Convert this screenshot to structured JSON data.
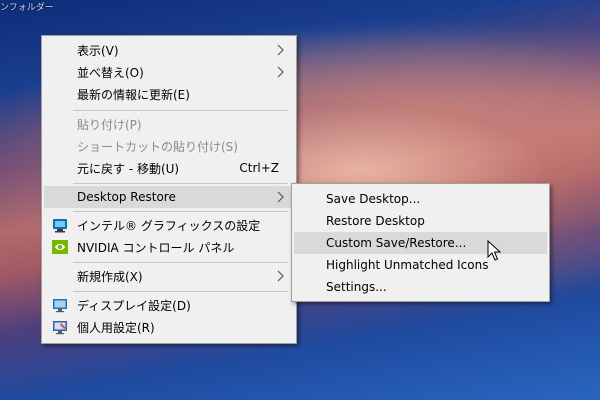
{
  "desktop": {
    "corner_label": "ンフォルダー"
  },
  "context_menu": {
    "items": [
      {
        "label": "表示(V)",
        "submenu": true
      },
      {
        "label": "並べ替え(O)",
        "submenu": true
      },
      {
        "label": "最新の情報に更新(E)"
      },
      {
        "label": "貼り付け(P)",
        "disabled": true
      },
      {
        "label": "ショートカットの貼り付け(S)",
        "disabled": true
      },
      {
        "label": "元に戻す - 移動(U)",
        "shortcut": "Ctrl+Z"
      },
      {
        "label": "Desktop Restore",
        "submenu": true,
        "highlighted": true
      },
      {
        "label": "インテル® グラフィックスの設定",
        "icon": "intel-graphics-icon"
      },
      {
        "label": "NVIDIA コントロール パネル",
        "icon": "nvidia-icon"
      },
      {
        "label": "新規作成(X)",
        "submenu": true
      },
      {
        "label": "ディスプレイ設定(D)",
        "icon": "display-icon"
      },
      {
        "label": "個人用設定(R)",
        "icon": "personalize-icon"
      }
    ]
  },
  "submenu": {
    "items": [
      {
        "label": "Save Desktop..."
      },
      {
        "label": "Restore Desktop"
      },
      {
        "label": "Custom Save/Restore...",
        "highlighted": true
      },
      {
        "label": "Highlight Unmatched Icons"
      },
      {
        "label": "Settings..."
      }
    ]
  },
  "colors": {
    "menu_bg": "#f0f0f0",
    "highlight": "#d9d9d9",
    "disabled_text": "#8a8a8a",
    "nvidia_green": "#76b900",
    "intel_blue": "#0071c5"
  }
}
